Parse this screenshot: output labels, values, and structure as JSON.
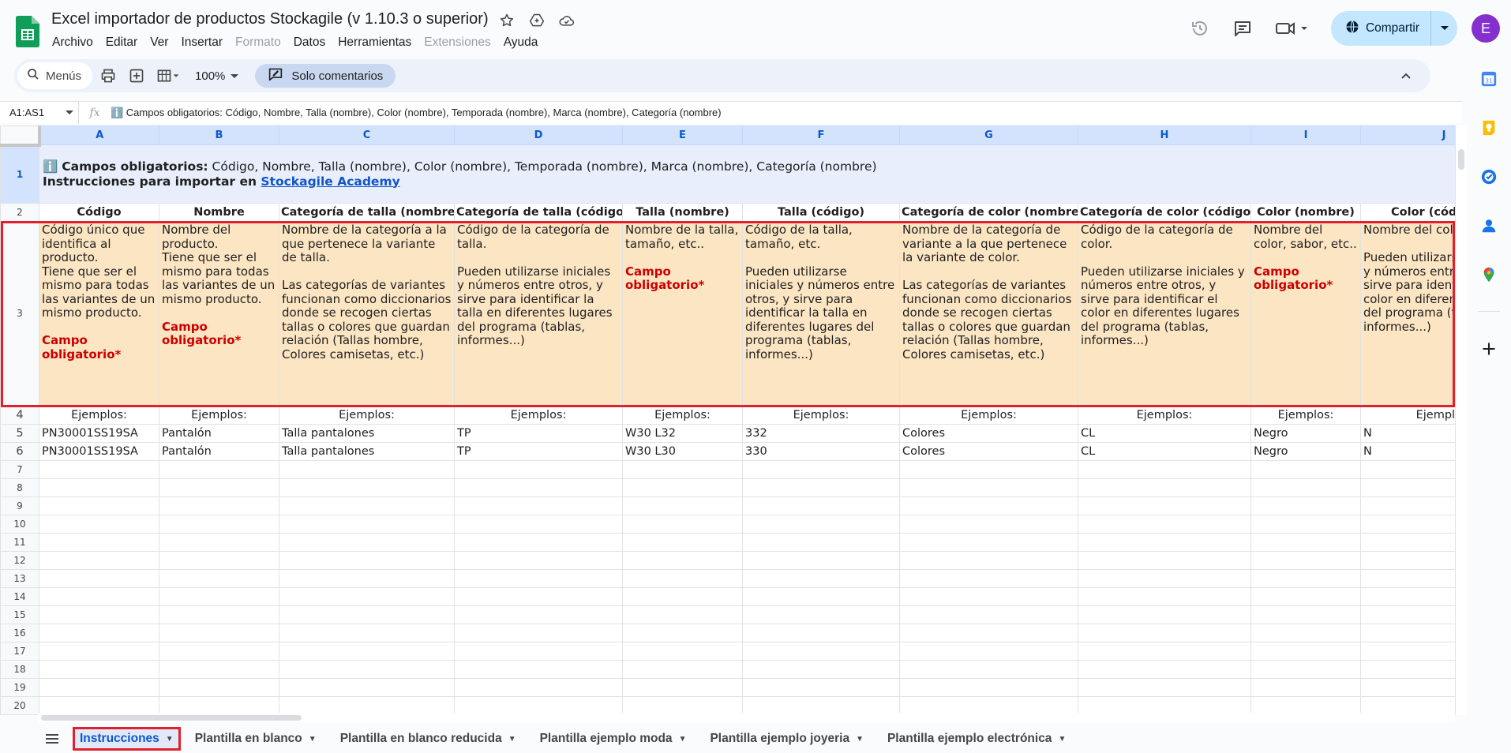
{
  "app": {
    "doc_title": "Excel importador de productos Stockagile (v 1.10.3 o superior)",
    "menu": [
      "Archivo",
      "Editar",
      "Ver",
      "Insertar",
      "Formato",
      "Datos",
      "Herramientas",
      "Extensiones",
      "Ayuda"
    ],
    "menu_disabled": [
      "Formato",
      "Extensiones"
    ],
    "share_label": "Compartir",
    "avatar_letter": "E"
  },
  "toolbar": {
    "search_label": "Menús",
    "zoom": "100%",
    "mode_label": "Solo comentarios"
  },
  "formula_bar": {
    "name_box": "A1:AS1",
    "fx": "fx",
    "formula": "ℹ️ Campos obligatorios: Código, Nombre, Talla (nombre), Color (nombre), Temporada (nombre), Marca (nombre), Categoría (nombre)"
  },
  "grid": {
    "columns": [
      "A",
      "B",
      "C",
      "D",
      "E",
      "F",
      "G",
      "H",
      "I",
      "J"
    ],
    "row_numbers": [
      "1",
      "2",
      "3",
      "4",
      "5",
      "6",
      "7",
      "8",
      "9",
      "10",
      "11",
      "12",
      "13",
      "14",
      "15",
      "16",
      "17",
      "18",
      "19",
      "20"
    ],
    "row1": {
      "icon": "ℹ️",
      "bold_prefix": "Campos obligatorios:",
      "rest": " Código, Nombre, Talla (nombre), Color (nombre), Temporada (nombre), Marca (nombre), Categoría (nombre)",
      "line2_bold": "Instrucciones para importar en ",
      "link_text": "Stockagile Academy"
    },
    "headers": [
      "Código",
      "Nombre",
      "Categoría de talla (nombre)",
      "Categoría de talla (código)",
      "Talla (nombre)",
      "Talla (código)",
      "Categoría de color (nombre)",
      "Categoría de color (código)",
      "Color (nombre)",
      "Color (cód"
    ],
    "descriptions": [
      {
        "text": "Código único que identifica al producto.\nTiene que ser el mismo para todas las variantes de un mismo producto.",
        "required": "Campo obligatorio*"
      },
      {
        "text": "Nombre del producto.\nTiene que ser el mismo para todas las variantes de un mismo producto.",
        "required": "Campo obligatorio*"
      },
      {
        "text": "Nombre de la categoría a la que pertenece la variante de talla.\n\nLas categorías de variantes funcionan como diccionarios donde se recogen ciertas tallas o colores que guardan relación (Tallas hombre, Colores camisetas, etc.)",
        "required": ""
      },
      {
        "text": "Código de la categoría de talla.\n\nPueden utilizarse iniciales y números entre otros, y sirve para identificar la talla en diferentes lugares del programa (tablas, informes...)",
        "required": ""
      },
      {
        "text": "Nombre de la talla, tamaño, etc..",
        "required": "Campo obligatorio*"
      },
      {
        "text": "Código de la talla, tamaño, etc.\n\nPueden utilizarse iniciales y números entre otros, y sirve para identificar la talla en diferentes lugares del programa (tablas, informes...)",
        "required": ""
      },
      {
        "text": "Nombre de la categoría de variante a la que pertenece la variante de color.\n\nLas categorías de variantes funcionan como diccionarios donde se recogen ciertas tallas o colores que guardan relación (Tallas hombre, Colores camisetas, etc.)",
        "required": ""
      },
      {
        "text": "Código de la categoría de color.\n\nPueden utilizarse iniciales y números entre otros, y sirve para identificar el color en diferentes lugares del programa (tablas, informes...)",
        "required": ""
      },
      {
        "text": "Nombre del color, sabor, etc..",
        "required": "Campo obligatorio*"
      },
      {
        "text": "Nombre del color, etc.\n\nPueden utilizarse iniciales y números entre otros, y sirve para identificar el color en diferentes lugares del programa (tablas, informes...)",
        "required": ""
      }
    ],
    "examples_label": [
      "Ejemplos:",
      "Ejemplos:",
      "Ejemplos:",
      "Ejemplos:",
      "Ejemplos:",
      "Ejemplos:",
      "Ejemplos:",
      "Ejemplos:",
      "Ejemplos:",
      "Ejemplos:"
    ],
    "data_rows": [
      [
        "PN30001SS19SA",
        "Pantalón",
        "Talla pantalones",
        "TP",
        "W30 L32",
        "332",
        "Colores",
        "CL",
        "Negro",
        "N"
      ],
      [
        "PN30001SS19SA",
        "Pantalón",
        "Talla pantalones",
        "TP",
        "W30 L30",
        "330",
        "Colores",
        "CL",
        "Negro",
        "N"
      ]
    ]
  },
  "sheets": [
    {
      "label": "Instrucciones",
      "active": true
    },
    {
      "label": "Plantilla en blanco",
      "active": false
    },
    {
      "label": "Plantilla en blanco reducida",
      "active": false
    },
    {
      "label": "Plantilla ejemplo moda",
      "active": false
    },
    {
      "label": "Plantilla ejemplo joyeria",
      "active": false
    },
    {
      "label": "Plantilla ejemplo electrónica",
      "active": false
    }
  ],
  "colors": {
    "accent": "#0b57d0",
    "share_bg": "#c2e7ff",
    "row1_bg": "#e8eefb",
    "desc_bg": "#fce5c3",
    "required_text": "#cc0000",
    "highlight_box": "#e0202c",
    "avatar": "#8430ce"
  },
  "icons": [
    "sheets-logo-icon",
    "star-icon",
    "move-to-drive-icon",
    "cloud-status-icon",
    "history-icon",
    "comments-icon",
    "meet-icon",
    "globe-icon",
    "search-icon",
    "print-icon",
    "insert-box-icon",
    "format-table-icon",
    "comment-mode-icon",
    "chevron-up-icon",
    "calendar-icon",
    "keep-icon",
    "tasks-icon",
    "contacts-icon",
    "maps-icon",
    "plus-icon",
    "all-sheets-icon"
  ]
}
